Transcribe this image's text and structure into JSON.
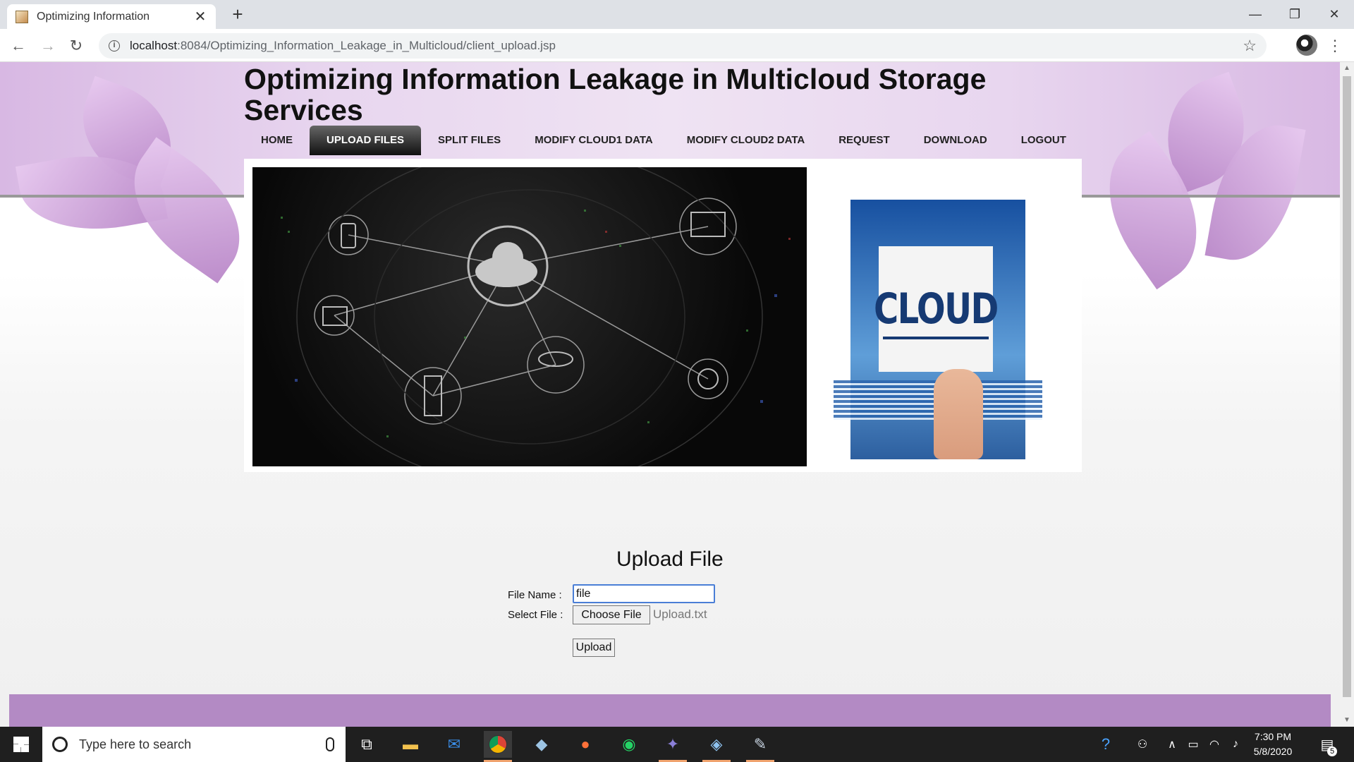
{
  "browser": {
    "tab_title": "Optimizing Information",
    "tab_close": "✕",
    "new_tab": "+",
    "url_host": "localhost",
    "url_rest": ":8084/Optimizing_Information_Leakage_in_Multicloud/client_upload.jsp",
    "controls": {
      "minimize": "—",
      "restore": "❐",
      "close": "✕"
    },
    "nav": {
      "back": "←",
      "forward": "→",
      "reload": "↻"
    }
  },
  "site": {
    "title": "Optimizing Information Leakage in Multicloud Storage Services",
    "menu": [
      {
        "label": "HOME",
        "active": false
      },
      {
        "label": "UPLOAD FILES",
        "active": true
      },
      {
        "label": "SPLIT FILES",
        "active": false
      },
      {
        "label": "MODIFY CLOUD1 DATA",
        "active": false
      },
      {
        "label": "MODIFY CLOUD2 DATA",
        "active": false
      },
      {
        "label": "REQUEST",
        "active": false
      },
      {
        "label": "DOWNLOAD",
        "active": false
      },
      {
        "label": "LOGOUT",
        "active": false
      }
    ],
    "cloud_image_text": "CLOUD"
  },
  "form": {
    "heading": "Upload File",
    "file_name_label": "File Name :",
    "file_name_value": "file",
    "select_file_label": "Select File :",
    "choose_button": "Choose File",
    "chosen_file": "Upload.txt",
    "upload_button": "Upload"
  },
  "taskbar": {
    "search_placeholder": "Type here to search",
    "time": "7:30 PM",
    "date": "5/8/2020",
    "notification_count": "5"
  },
  "colors": {
    "header_band": "#e8d6ef",
    "active_menu": "#222222",
    "footer_bar": "#b38ac4",
    "input_focus": "#4a7ed6"
  }
}
